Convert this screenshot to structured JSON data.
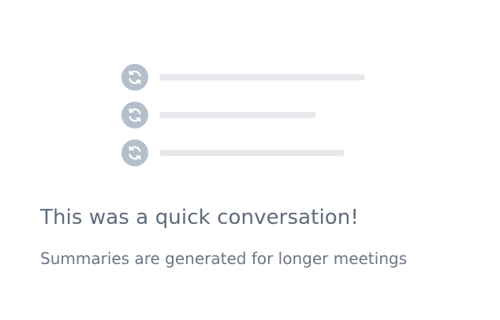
{
  "empty_state": {
    "title": "This was a quick conversation!",
    "subtitle": "Summaries are generated for longer meetings"
  },
  "illustration": {
    "icon": "refresh-icon",
    "rows": [
      {
        "icon": "refresh-icon"
      },
      {
        "icon": "refresh-icon"
      },
      {
        "icon": "refresh-icon"
      }
    ]
  },
  "colors": {
    "icon_bg": "#b4bfcc",
    "placeholder_line": "#e6e8ec",
    "title_text": "#5f6b7a",
    "subtitle_text": "#6c7684"
  }
}
